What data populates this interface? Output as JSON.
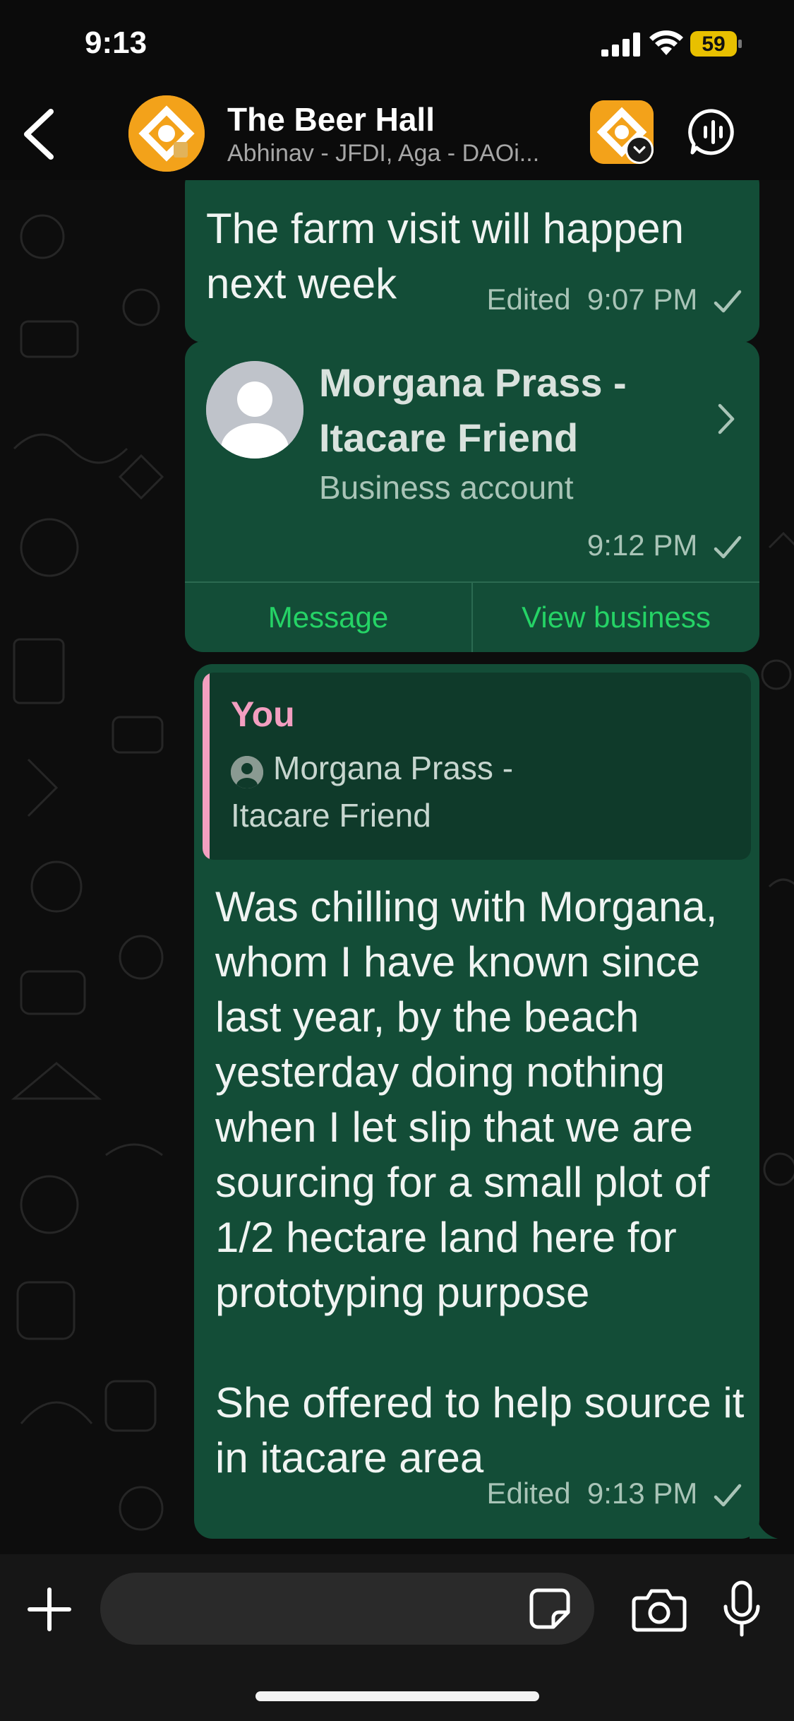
{
  "status_bar": {
    "time": "9:13",
    "battery": "59",
    "icons": [
      "cellular-signal-icon",
      "wifi-icon",
      "battery-icon"
    ]
  },
  "header": {
    "title": "The Beer Hall",
    "subtitle": "Abhinav - JFDI, Aga - DAOi...",
    "icons": [
      "back-chevron-icon",
      "group-avatar",
      "community-icon",
      "group-call-icon"
    ]
  },
  "messages": [
    {
      "text": "The farm visit will happen next week",
      "edited": "Edited",
      "time": "9:07 PM"
    },
    {
      "contact_card": {
        "name": "Morgana Prass - Itacare Friend",
        "type": "Business account",
        "time": "9:12 PM",
        "actions": {
          "message": "Message",
          "view_business": "View business"
        }
      }
    },
    {
      "reply_to": {
        "author": "You",
        "contact_line1": "Morgana Prass -",
        "contact_line2": "Itacare Friend"
      },
      "text": "Was chilling with Morgana, whom I have known since last year, by the beach yesterday doing nothing when I let slip that we are sourcing for a small plot of 1/2 hectare land here for prototyping purpose\n\nShe offered to help source it in itacare area",
      "edited": "Edited",
      "time": "9:13 PM"
    }
  ],
  "input": {
    "value": "",
    "icons": [
      "plus-icon",
      "sticker-icon",
      "camera-icon",
      "microphone-icon"
    ]
  },
  "colors": {
    "outgoing_bubble": "#134d37",
    "accent_green": "#25d366",
    "quote_author_pink": "#f39ec0",
    "battery_yellow": "#e8c000",
    "brand_orange": "#f3a21a"
  }
}
